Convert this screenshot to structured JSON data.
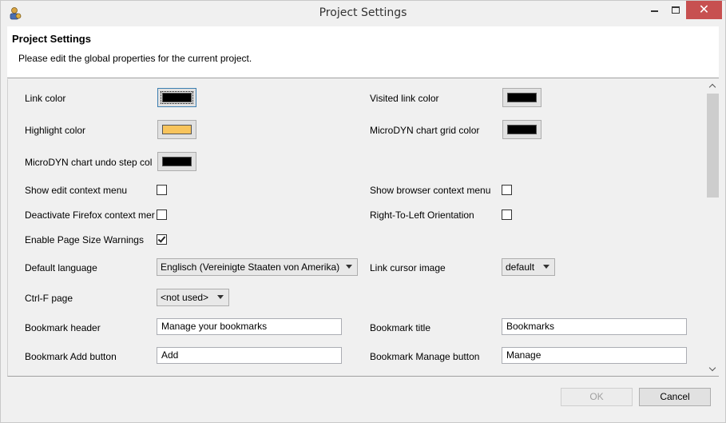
{
  "window": {
    "title": "Project Settings",
    "minimize_icon": "minimize-icon",
    "maximize_icon": "maximize-icon",
    "close_label": "✕"
  },
  "header": {
    "title": "Project Settings",
    "description": "Please edit the global properties for the current project."
  },
  "settings": {
    "link_color": {
      "label": "Link color",
      "color": "#000000"
    },
    "visited_link_color": {
      "label": "Visited link color",
      "color": "#000000"
    },
    "highlight_color": {
      "label": "Highlight color",
      "color": "#f8c45c"
    },
    "microdyn_grid_color": {
      "label": "MicroDYN chart grid color",
      "color": "#000000"
    },
    "microdyn_undo_color": {
      "label": "MicroDYN chart undo step col",
      "color": "#000000"
    },
    "show_edit_context_menu": {
      "label": "Show edit context menu",
      "checked": false
    },
    "show_browser_context_menu": {
      "label": "Show browser context menu",
      "checked": false
    },
    "deactivate_firefox_menu": {
      "label": "Deactivate Firefox context mer",
      "checked": false
    },
    "rtl_orientation": {
      "label": "Right-To-Left Orientation",
      "checked": false
    },
    "page_size_warnings": {
      "label": "Enable Page Size Warnings",
      "checked": true
    },
    "default_language": {
      "label": "Default language",
      "value": "Englisch (Vereinigte Staaten von Amerika)"
    },
    "link_cursor_image": {
      "label": "Link cursor image",
      "value": "default"
    },
    "ctrl_f_page": {
      "label": "Ctrl-F page",
      "value": "<not used>"
    },
    "bookmark_header": {
      "label": "Bookmark header",
      "value": "Manage your bookmarks"
    },
    "bookmark_title": {
      "label": "Bookmark title",
      "value": "Bookmarks"
    },
    "bookmark_add_button": {
      "label": "Bookmark Add button",
      "value": "Add"
    },
    "bookmark_manage_button": {
      "label": "Bookmark Manage button",
      "value": "Manage"
    }
  },
  "footer": {
    "ok_label": "OK",
    "cancel_label": "Cancel"
  }
}
